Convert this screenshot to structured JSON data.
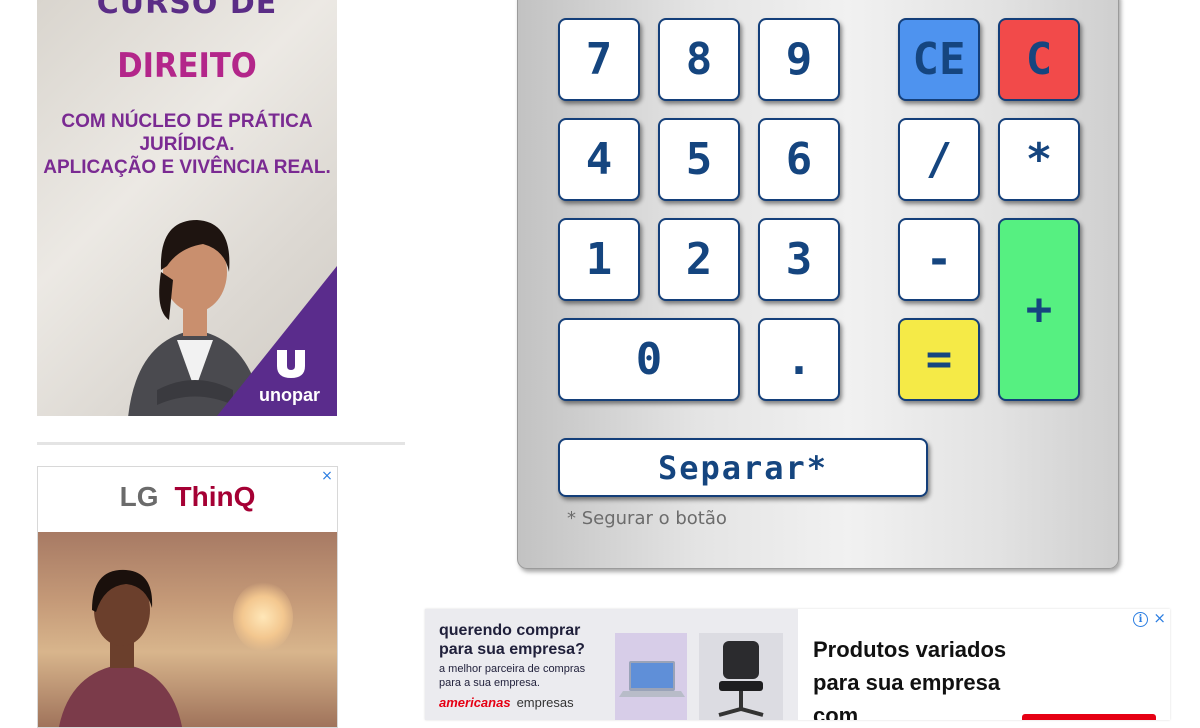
{
  "ads": {
    "left_top": {
      "headline_top": "CURSO DE",
      "headline_main": "DIREITO",
      "subline_1": "COM NÚCLEO DE PRÁTICA JURÍDICA.",
      "subline_2": "APLICAÇÃO E VIVÊNCIA REAL.",
      "logo": "unopar",
      "accent_purple": "#5a2c8c",
      "accent_magenta": "#b3268a"
    },
    "left_bottom": {
      "brand_lg": "LG",
      "brand_thinq": "ThinQ",
      "close_icon": "×",
      "accent": "#a50034"
    },
    "bottom_banner": {
      "tagline_1": "querendo comprar para sua empresa?",
      "tagline_2": "a melhor parceira de compras para a sua empresa.",
      "store_name": "americanas",
      "store_suffix": "empresas",
      "headline": "Produtos variados para sua empresa com",
      "info_icon": "i",
      "close_icon": "×",
      "accent": "#e60014"
    }
  },
  "calculator": {
    "keys": {
      "seven": "7",
      "eight": "8",
      "nine": "9",
      "ce": "CE",
      "c": "C",
      "four": "4",
      "five": "5",
      "six": "6",
      "divide": "/",
      "multiply": "*",
      "one": "1",
      "two": "2",
      "three": "3",
      "minus": "-",
      "plus": "+",
      "zero": "0",
      "dot": ".",
      "equals": "="
    },
    "separate_button": "Separar*",
    "hint": "* Segurar o botão",
    "colors": {
      "key_text": "#15457f",
      "ce": "#4e93ef",
      "c": "#f24a4a",
      "equals": "#f5ea47",
      "plus": "#56f081"
    }
  }
}
